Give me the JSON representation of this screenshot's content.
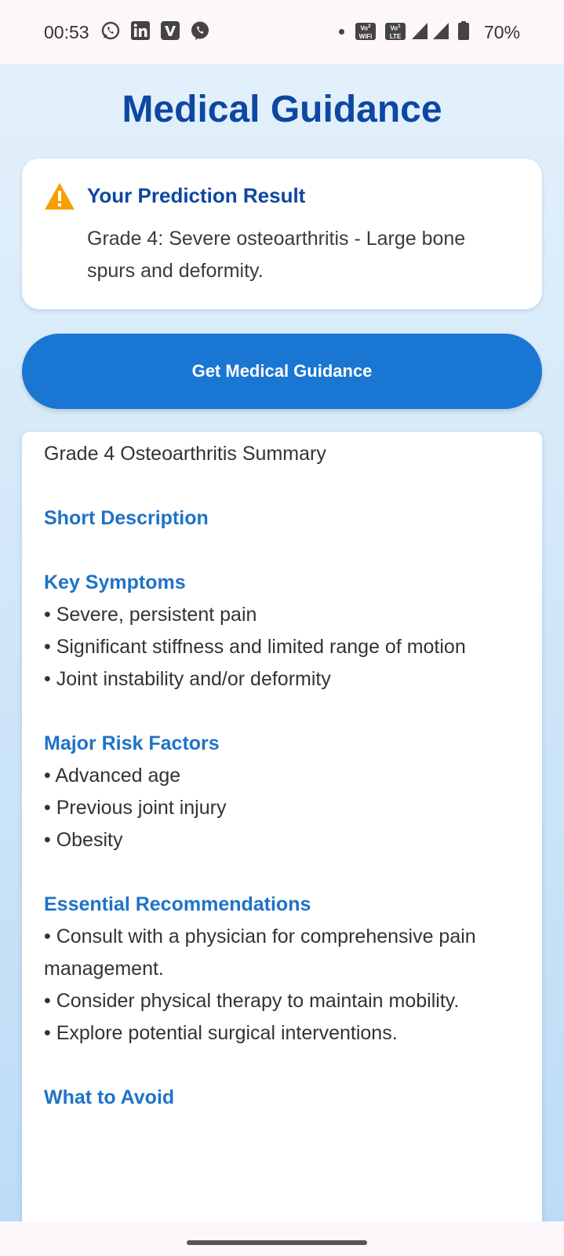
{
  "status_bar": {
    "time": "00:53",
    "notification_icons": [
      "whatsapp-icon",
      "linkedin-icon",
      "v-app-icon",
      "viber-icon"
    ],
    "right_chips": [
      {
        "top": "Vo",
        "sub": "WiFi",
        "num": "2"
      },
      {
        "top": "Vo",
        "sub": "LTE",
        "num": "1"
      }
    ],
    "battery": "70%"
  },
  "page": {
    "title": "Medical Guidance"
  },
  "prediction_card": {
    "icon": "warning-icon",
    "heading": "Your Prediction Result",
    "text": "Grade 4: Severe osteoarthritis - Large bone spurs and deformity."
  },
  "guidance_button": {
    "label": "Get Medical Guidance",
    "color": "#1976d2"
  },
  "guidance": {
    "summary_title": "Grade 4 Osteoarthritis Summary",
    "sections": [
      {
        "heading": "Short Description",
        "items": []
      },
      {
        "heading": "Key Symptoms",
        "items": [
          "• Severe, persistent pain",
          "• Significant stiffness and limited range of motion",
          "• Joint instability and/or deformity"
        ]
      },
      {
        "heading": "Major Risk Factors",
        "items": [
          "• Advanced age",
          "• Previous joint injury",
          "• Obesity"
        ]
      },
      {
        "heading": "Essential Recommendations",
        "items": [
          "• Consult with a physician for comprehensive pain management.",
          "• Consider physical therapy to maintain mobility.",
          "• Explore potential surgical interventions."
        ]
      },
      {
        "heading": "What to Avoid",
        "items": []
      }
    ]
  },
  "colors": {
    "title": "#0d47a1",
    "section_heading": "#1e73c8",
    "warning": "#f5a000"
  }
}
